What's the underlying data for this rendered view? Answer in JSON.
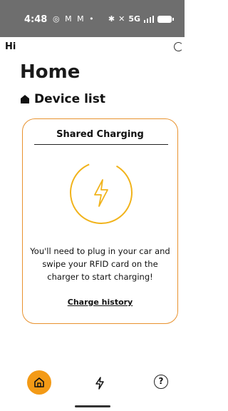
{
  "status_bar": {
    "time": "4:48",
    "left_icons": "◎ M M •",
    "network": "5G"
  },
  "header": {
    "greeting": "Hi",
    "title": "Home",
    "section": "Device list"
  },
  "card": {
    "title": "Shared Charging",
    "message": "You'll need to plug in your car and swipe your RFID card on the charger to start charging!",
    "link": "Charge history"
  },
  "nav": {
    "items": [
      "home",
      "charging",
      "help"
    ],
    "active": "home",
    "help_glyph": "?"
  },
  "colors": {
    "accent": "#f39a16",
    "card_border": "#e8922e",
    "status_bar": "#6e6e6e"
  }
}
